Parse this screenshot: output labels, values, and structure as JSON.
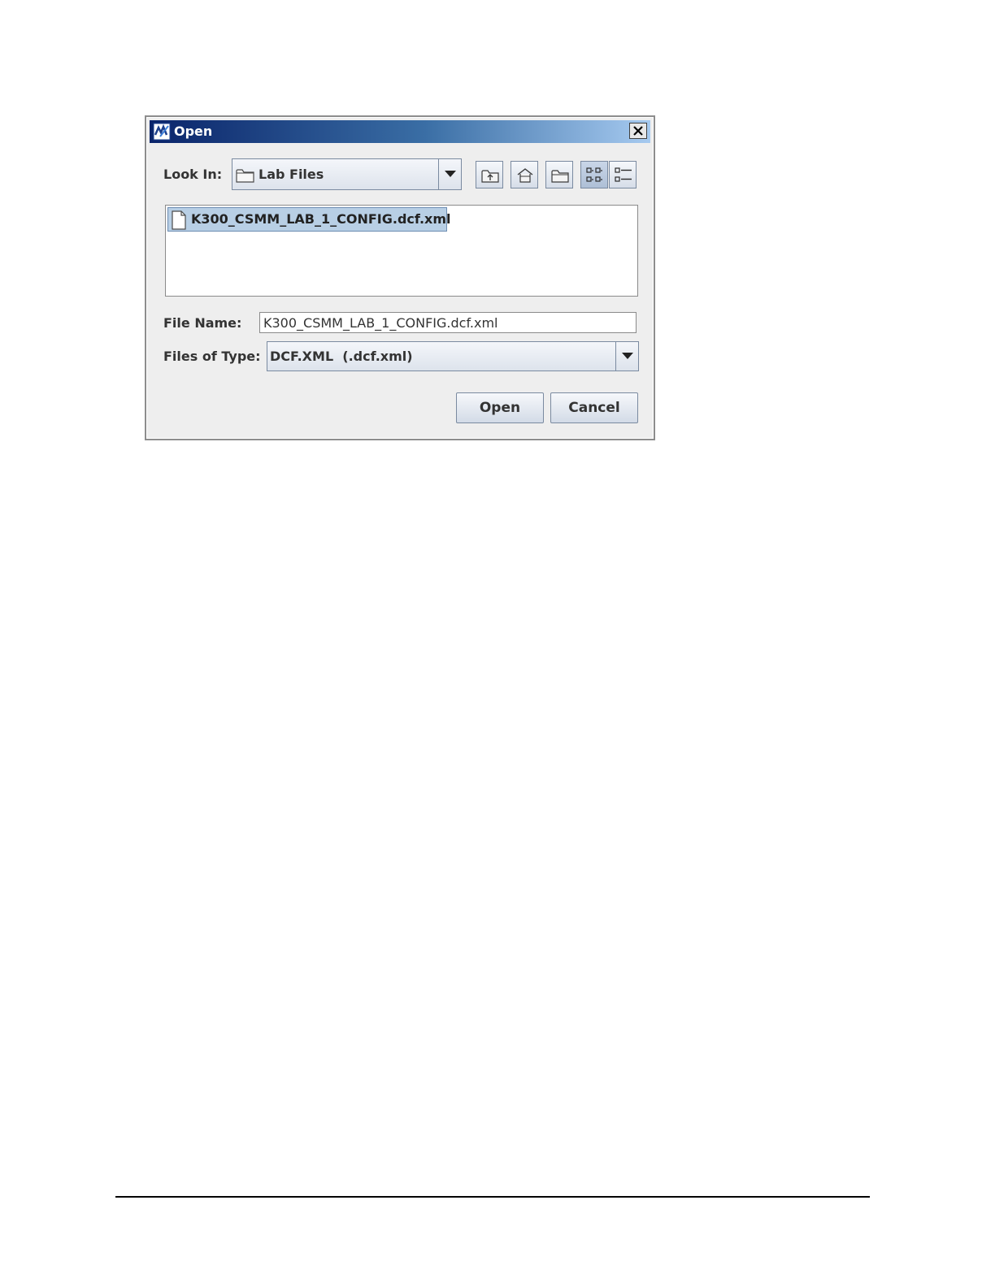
{
  "dialog": {
    "title": "Open",
    "look_in": {
      "label": "Look In:",
      "value": "Lab Files"
    },
    "toolbar": {
      "buttons": [
        {
          "name": "up-one-level",
          "icon": "folder-up-icon"
        },
        {
          "name": "home",
          "icon": "home-icon"
        },
        {
          "name": "create-new-folder",
          "icon": "new-folder-icon"
        },
        {
          "name": "list-view",
          "icon": "list-view-icon",
          "selected": true
        },
        {
          "name": "details-view",
          "icon": "details-view-icon",
          "selected": false
        }
      ]
    },
    "files": [
      {
        "name": "K300_CSMM_LAB_1_CONFIG.dcf.xml",
        "selected": true,
        "icon": "file-icon"
      }
    ],
    "file_name": {
      "label": "File Name:",
      "value": "K300_CSMM_LAB_1_CONFIG.dcf.xml"
    },
    "file_type": {
      "label": "Files of Type:",
      "value": "DCF.XML  (.dcf.xml)"
    },
    "open_label": "Open",
    "cancel_label": "Cancel"
  },
  "colors": {
    "title_gradient_start": "#0a246a",
    "title_gradient_end": "#a6caf0",
    "selection": "#b8cfe5",
    "dialog_bg": "#eeeeee"
  }
}
